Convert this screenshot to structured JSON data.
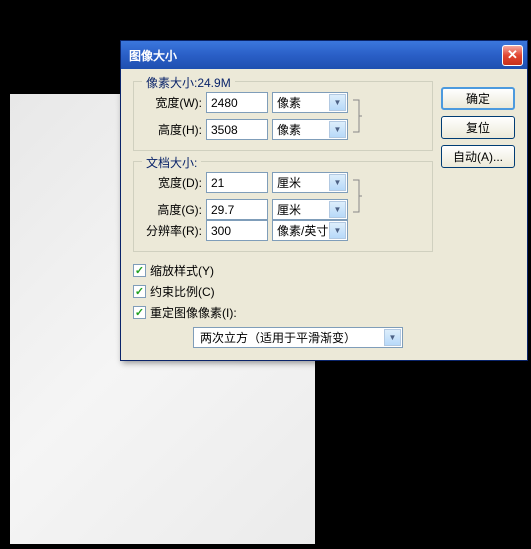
{
  "dialog": {
    "title": "图像大小"
  },
  "pixel_dims": {
    "legend": "像素大小:24.9M",
    "width_label": "宽度(W):",
    "width_value": "2480",
    "width_unit": "像素",
    "height_label": "高度(H):",
    "height_value": "3508",
    "height_unit": "像素"
  },
  "doc_size": {
    "legend": "文档大小:",
    "width_label": "宽度(D):",
    "width_value": "21",
    "width_unit": "厘米",
    "height_label": "高度(G):",
    "height_value": "29.7",
    "height_unit": "厘米",
    "res_label": "分辨率(R):",
    "res_value": "300",
    "res_unit": "像素/英寸"
  },
  "checkboxes": {
    "scale_styles": "缩放样式(Y)",
    "constrain": "约束比例(C)",
    "resample": "重定图像像素(I):"
  },
  "resample_method": "两次立方（适用于平滑渐变）",
  "buttons": {
    "ok": "确定",
    "reset": "复位",
    "auto": "自动(A)..."
  }
}
